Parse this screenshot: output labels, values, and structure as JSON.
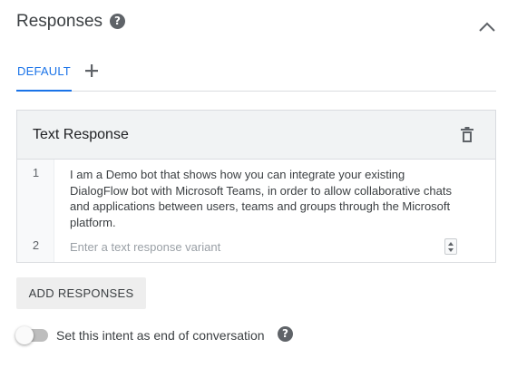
{
  "section": {
    "title": "Responses",
    "help_icon": "help-circle-icon",
    "collapse_icon": "chevron-up-icon"
  },
  "tabs": {
    "items": [
      {
        "label": "DEFAULT",
        "active": true
      }
    ],
    "add_icon": "plus-icon"
  },
  "text_response": {
    "title": "Text Response",
    "delete_icon": "trash-icon",
    "lines": [
      {
        "number": "1",
        "text": "I am a Demo bot that shows how you can integrate your existing DialogFlow bot with Microsoft Teams, in order to allow collaborative chats and applications between users, teams and groups through the Microsoft platform."
      },
      {
        "number": "2",
        "value": "",
        "placeholder": "Enter a text response variant"
      }
    ]
  },
  "add_responses_label": "ADD RESPONSES",
  "end_conversation": {
    "label": "Set this intent as end of conversation",
    "enabled": false,
    "help_icon": "help-circle-icon"
  },
  "colors": {
    "accent": "#1a73e8",
    "header_bg": "#f1f3f4",
    "button_bg": "#eeeeee"
  }
}
